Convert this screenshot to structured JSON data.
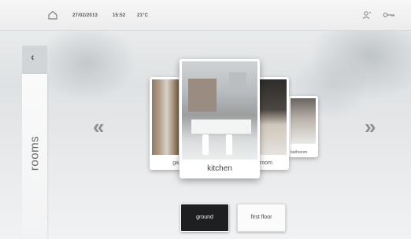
{
  "status_bar": {
    "date": "27/02/2013",
    "time": "15:52",
    "temperature": "21°C",
    "icons": [
      "home-icon",
      "user-icon",
      "key-icon"
    ]
  },
  "sidebar": {
    "back_label": "‹",
    "title": "rooms"
  },
  "carousel": {
    "prev_label": "«",
    "next_label": "»",
    "rooms": [
      {
        "label": "ga"
      },
      {
        "label": "kitchen",
        "selected": true
      },
      {
        "label": "room"
      },
      {
        "label": "bathroom"
      }
    ]
  },
  "floors": [
    {
      "label": "ground",
      "selected": true
    },
    {
      "label": "first floor",
      "selected": false
    }
  ]
}
